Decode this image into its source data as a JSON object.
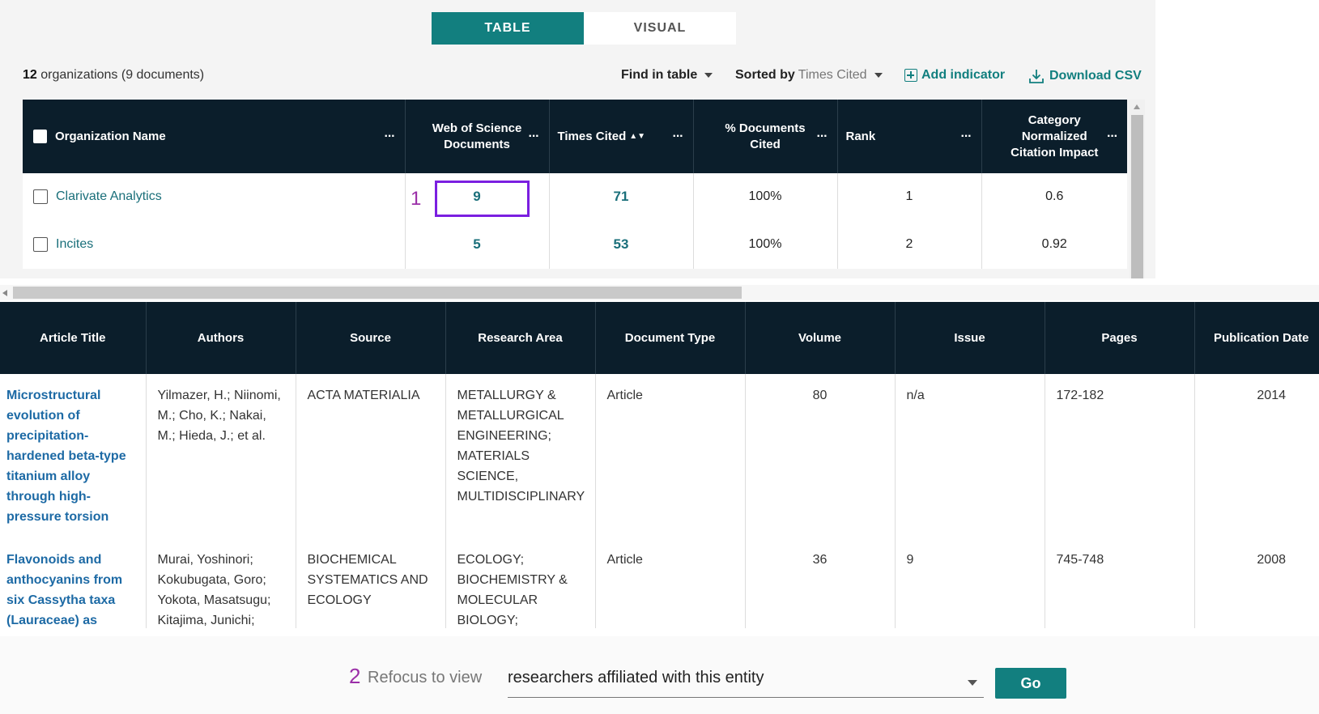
{
  "view_toggle": {
    "table_label": "TABLE",
    "visual_label": "VISUAL"
  },
  "summary": {
    "count": "12",
    "rest": " organizations (9 documents)"
  },
  "toolbar": {
    "find_label": "Find in table",
    "sorted_prefix": "Sorted by",
    "sorted_value": "Times Cited",
    "add_indicator": "Add indicator",
    "download_csv": "Download CSV"
  },
  "org_table": {
    "headers": {
      "org_name": "Organization Name",
      "wos_docs_1": "Web of Science",
      "wos_docs_2": "Documents",
      "times_cited": "Times Cited",
      "pct_cited_1": "% Documents",
      "pct_cited_2": "Cited",
      "rank": "Rank",
      "cnci_1": "Category",
      "cnci_2": "Normalized",
      "cnci_3": "Citation Impact",
      "menu": "···"
    },
    "rows": [
      {
        "name": "Clarivate Analytics",
        "wos_docs": "9",
        "times_cited": "71",
        "pct_cited": "100%",
        "rank": "1",
        "cnci": "0.6"
      },
      {
        "name": "Incites",
        "wos_docs": "5",
        "times_cited": "53",
        "pct_cited": "100%",
        "rank": "2",
        "cnci": "0.92"
      }
    ]
  },
  "annotations": {
    "one": "1",
    "two": "2"
  },
  "article_table": {
    "headers": {
      "title": "Article Title",
      "authors": "Authors",
      "source": "Source",
      "research_area": "Research Area",
      "doc_type": "Document Type",
      "volume": "Volume",
      "issue": "Issue",
      "pages": "Pages",
      "pub_date": "Publication Date"
    },
    "rows": [
      {
        "title": "Microstructural evolution of precipitation-hardened beta-type titanium alloy through high-pressure torsion",
        "authors": "Yilmazer, H.; Niinomi, M.; Cho, K.; Nakai, M.; Hieda, J.; et al.",
        "source": "ACTA MATERIALIA",
        "research_area": "METALLURGY & METALLURGICAL ENGINEERING; MATERIALS SCIENCE, MULTIDISCIPLINARY",
        "doc_type": "Article",
        "volume": "80",
        "issue": "n/a",
        "pages": "172-182",
        "pub_date": "2014"
      },
      {
        "title": "Flavonoids and anthocyanins from six Cassytha taxa (Lauraceae) as",
        "authors": "Murai, Yoshinori; Kokubugata, Goro; Yokota, Masatsugu; Kitajima, Junichi;",
        "source": "BIOCHEMICAL SYSTEMATICS AND ECOLOGY",
        "research_area": "ECOLOGY; BIOCHEMISTRY & MOLECULAR BIOLOGY;",
        "doc_type": "Article",
        "volume": "36",
        "issue": "9",
        "pages": "745-748",
        "pub_date": "2008"
      }
    ]
  },
  "refocus": {
    "label": "Refocus to view",
    "selected": "researchers affiliated with this entity",
    "go_label": "Go"
  },
  "colors": {
    "teal": "#127f7f",
    "header_dark": "#0b1e2b",
    "annotation_purple": "#9b2fa8",
    "highlight": "#7b1fe0"
  }
}
